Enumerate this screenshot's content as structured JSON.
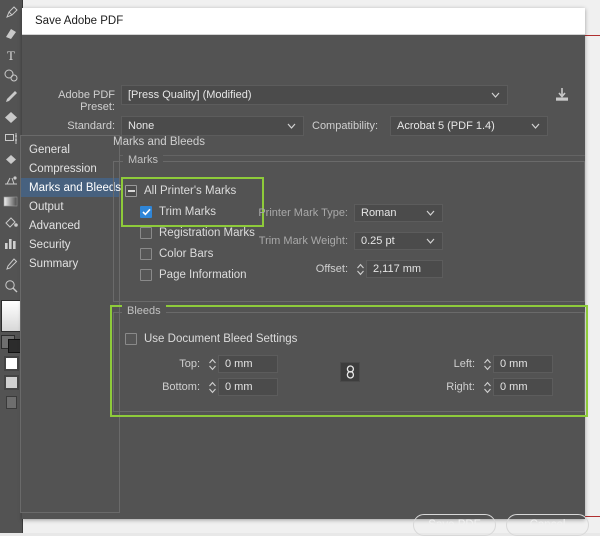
{
  "window": {
    "title": "Save Adobe PDF"
  },
  "preset": {
    "label": "Adobe PDF Preset:",
    "value": "[Press Quality] (Modified)",
    "save_icon": "save-preset-icon"
  },
  "standard": {
    "label": "Standard:",
    "value": "None"
  },
  "compatibility": {
    "label": "Compatibility:",
    "value": "Acrobat 5 (PDF 1.4)"
  },
  "sidebar": {
    "items": [
      {
        "label": "General",
        "selected": false
      },
      {
        "label": "Compression",
        "selected": false
      },
      {
        "label": "Marks and Bleeds",
        "selected": true
      },
      {
        "label": "Output",
        "selected": false
      },
      {
        "label": "Advanced",
        "selected": false
      },
      {
        "label": "Security",
        "selected": false
      },
      {
        "label": "Summary",
        "selected": false
      }
    ]
  },
  "panel": {
    "title": "Marks and Bleeds"
  },
  "marks": {
    "legend": "Marks",
    "all_printers_marks": {
      "label": "All Printer's Marks",
      "state": "mixed"
    },
    "trim_marks": {
      "label": "Trim Marks",
      "state": "checked"
    },
    "registration_marks": {
      "label": "Registration Marks",
      "state": "unchecked"
    },
    "color_bars": {
      "label": "Color Bars",
      "state": "unchecked"
    },
    "page_information": {
      "label": "Page Information",
      "state": "unchecked"
    },
    "printer_mark_type": {
      "label": "Printer Mark Type:",
      "value": "Roman"
    },
    "trim_mark_weight": {
      "label": "Trim Mark Weight:",
      "value": "0.25 pt"
    },
    "offset": {
      "label": "Offset:",
      "value": "2,117 mm"
    }
  },
  "bleeds": {
    "legend": "Bleeds",
    "use_document": {
      "label": "Use Document Bleed Settings",
      "state": "unchecked"
    },
    "top": {
      "label": "Top:",
      "value": "0 mm"
    },
    "bottom": {
      "label": "Bottom:",
      "value": "0 mm"
    },
    "left": {
      "label": "Left:",
      "value": "0 mm"
    },
    "right": {
      "label": "Right:",
      "value": "0 mm"
    },
    "link_icon": "chain-link-icon"
  },
  "footer": {
    "save": "Save PDF",
    "cancel": "Cancel"
  },
  "highlights": {
    "color": "#8ecb3a",
    "regions": [
      "all-printers-marks-and-trim-marks",
      "bleeds-group"
    ]
  },
  "colors": {
    "dialog_bg": "#535353",
    "field_bg": "#4b4b4b",
    "titlebar_bg": "#ffffff",
    "selection_blue": "#47617f",
    "checkbox_blue": "#2f86d8",
    "highlight_green": "#8ecb3a"
  },
  "toolstrip": {
    "tools": [
      "pen-icon",
      "eraser-icon",
      "type-icon",
      "ellipse-icon",
      "paintbrush-icon",
      "gradient-diamond-icon",
      "artboard-icon",
      "shape-builder-icon",
      "perspective-icon",
      "gradient-icon",
      "live-paint-icon",
      "graph-icon",
      "eyedropper-icon",
      "zoom-icon"
    ]
  }
}
